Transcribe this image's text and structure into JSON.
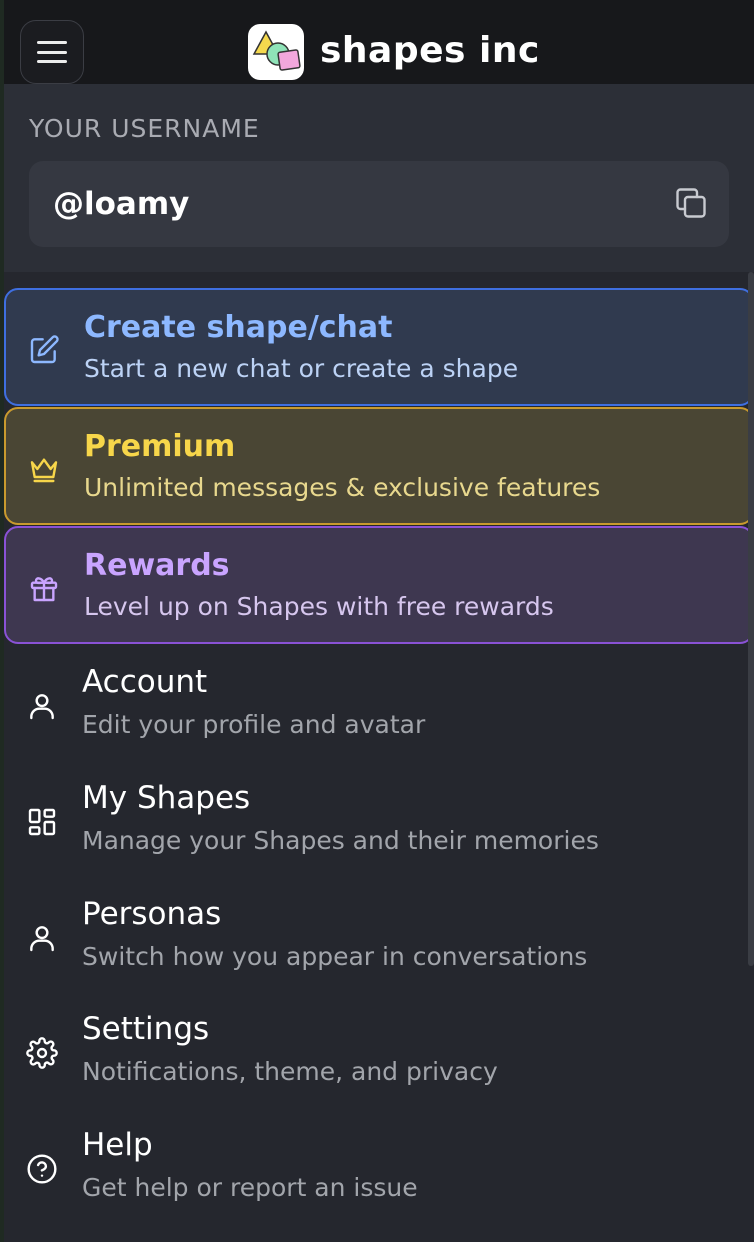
{
  "header": {
    "brand": "shapes inc",
    "menu_icon": "hamburger-icon",
    "logo_icon": "shapes-logo"
  },
  "username": {
    "label": "YOUR USERNAME",
    "value": "@loamy",
    "copy_icon": "copy-icon"
  },
  "menu": {
    "create": {
      "title": "Create shape/chat",
      "subtitle": "Start a new chat or create a shape",
      "icon": "edit-icon"
    },
    "premium": {
      "title": "Premium",
      "subtitle": "Unlimited messages & exclusive features",
      "icon": "crown-icon"
    },
    "rewards": {
      "title": "Rewards",
      "subtitle": "Level up on Shapes with free rewards",
      "icon": "gift-icon"
    },
    "account": {
      "title": "Account",
      "subtitle": "Edit your profile and avatar",
      "icon": "user-icon"
    },
    "my_shapes": {
      "title": "My Shapes",
      "subtitle": "Manage your Shapes and their memories",
      "icon": "grid-icon"
    },
    "personas": {
      "title": "Personas",
      "subtitle": "Switch how you appear in conversations",
      "icon": "user-icon"
    },
    "settings": {
      "title": "Settings",
      "subtitle": "Notifications, theme, and privacy",
      "icon": "gear-icon"
    },
    "help": {
      "title": "Help",
      "subtitle": "Get help or report an issue",
      "icon": "help-circle-icon"
    }
  },
  "colors": {
    "create_accent": "#8db8ff",
    "premium_accent": "#f7d64a",
    "rewards_accent": "#c9a4ff"
  }
}
